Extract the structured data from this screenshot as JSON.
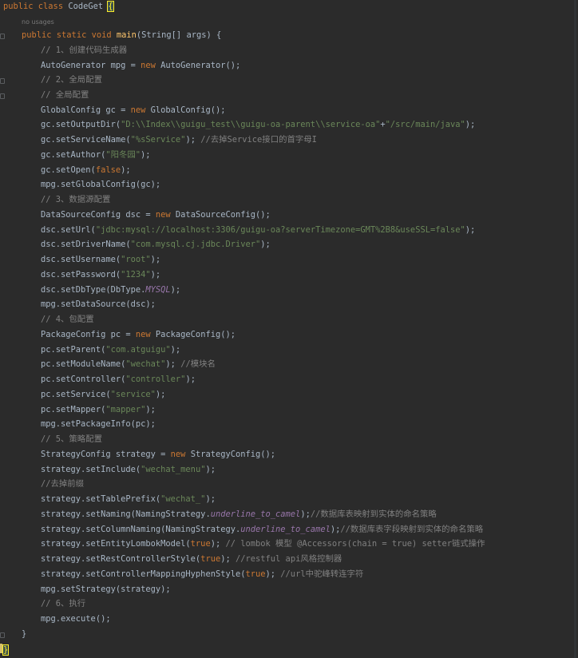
{
  "editor": {
    "usage_hint": "no usages",
    "lines": [
      {
        "indent": 0,
        "tokens": [
          [
            "kw",
            "public class "
          ],
          [
            "plain",
            "CodeGet "
          ],
          [
            "brace",
            "{"
          ]
        ]
      },
      {
        "indent": 0,
        "tokens": []
      },
      {
        "indent": 1,
        "tokens": [
          [
            "kw",
            "public static void "
          ],
          [
            "fn",
            "main"
          ],
          [
            "plain",
            "(String[] args) {"
          ]
        ]
      },
      {
        "indent": 2,
        "tokens": [
          [
            "cmt",
            "// 1、创建代码生成器"
          ]
        ]
      },
      {
        "indent": 2,
        "tokens": [
          [
            "plain",
            "AutoGenerator mpg = "
          ],
          [
            "kw",
            "new "
          ],
          [
            "plain",
            "AutoGenerator();"
          ]
        ]
      },
      {
        "indent": 2,
        "tokens": [
          [
            "cmt",
            "// 2、全局配置"
          ]
        ]
      },
      {
        "indent": 2,
        "tokens": [
          [
            "cmt",
            "// 全局配置"
          ]
        ]
      },
      {
        "indent": 2,
        "tokens": [
          [
            "plain",
            "GlobalConfig gc = "
          ],
          [
            "kw",
            "new "
          ],
          [
            "plain",
            "GlobalConfig();"
          ]
        ]
      },
      {
        "indent": 2,
        "tokens": [
          [
            "plain",
            "gc.setOutputDir("
          ],
          [
            "str",
            "\"D:\\\\Index\\\\guigu_test\\\\guigu-oa-parent\\\\service-oa\""
          ],
          [
            "plain",
            "+"
          ],
          [
            "str",
            "\"/src/main/java\""
          ],
          [
            "plain",
            ");"
          ]
        ]
      },
      {
        "indent": 2,
        "tokens": [
          [
            "plain",
            "gc.setServiceName("
          ],
          [
            "str",
            "\"%sService\""
          ],
          [
            "plain",
            "); "
          ],
          [
            "cmt",
            "//去掉Service接口的首字母I"
          ]
        ]
      },
      {
        "indent": 2,
        "tokens": [
          [
            "plain",
            "gc.setAuthor("
          ],
          [
            "str",
            "\"阳冬园\""
          ],
          [
            "plain",
            ");"
          ]
        ]
      },
      {
        "indent": 2,
        "tokens": [
          [
            "plain",
            "gc.setOpen("
          ],
          [
            "kw",
            "false"
          ],
          [
            "plain",
            ");"
          ]
        ]
      },
      {
        "indent": 2,
        "tokens": [
          [
            "plain",
            "mpg.setGlobalConfig(gc);"
          ]
        ]
      },
      {
        "indent": 2,
        "tokens": [
          [
            "cmt",
            "// 3、数据源配置"
          ]
        ]
      },
      {
        "indent": 2,
        "tokens": [
          [
            "plain",
            "DataSourceConfig dsc = "
          ],
          [
            "kw",
            "new "
          ],
          [
            "plain",
            "DataSourceConfig();"
          ]
        ]
      },
      {
        "indent": 2,
        "tokens": [
          [
            "plain",
            "dsc.setUrl("
          ],
          [
            "str",
            "\"jdbc:mysql://localhost:3306/guigu-oa?serverTimezone=GMT%2B8&useSSL=false\""
          ],
          [
            "plain",
            ");"
          ]
        ]
      },
      {
        "indent": 2,
        "tokens": [
          [
            "plain",
            "dsc.setDriverName("
          ],
          [
            "str",
            "\"com.mysql.cj.jdbc.Driver\""
          ],
          [
            "plain",
            ");"
          ]
        ]
      },
      {
        "indent": 2,
        "tokens": [
          [
            "plain",
            "dsc.setUsername("
          ],
          [
            "str",
            "\"root\""
          ],
          [
            "plain",
            ");"
          ]
        ]
      },
      {
        "indent": 2,
        "tokens": [
          [
            "plain",
            "dsc.setPassword("
          ],
          [
            "str",
            "\"1234\""
          ],
          [
            "plain",
            ");"
          ]
        ]
      },
      {
        "indent": 2,
        "tokens": [
          [
            "plain",
            "dsc.setDbType(DbType."
          ],
          [
            "const",
            "MYSQL"
          ],
          [
            "plain",
            ");"
          ]
        ]
      },
      {
        "indent": 2,
        "tokens": [
          [
            "plain",
            "mpg.setDataSource(dsc);"
          ]
        ]
      },
      {
        "indent": 2,
        "tokens": [
          [
            "cmt",
            "// 4、包配置"
          ]
        ]
      },
      {
        "indent": 2,
        "tokens": [
          [
            "plain",
            "PackageConfig pc = "
          ],
          [
            "kw",
            "new "
          ],
          [
            "plain",
            "PackageConfig();"
          ]
        ]
      },
      {
        "indent": 2,
        "tokens": [
          [
            "plain",
            "pc.setParent("
          ],
          [
            "str",
            "\"com.atguigu\""
          ],
          [
            "plain",
            ");"
          ]
        ]
      },
      {
        "indent": 2,
        "tokens": [
          [
            "plain",
            "pc.setModuleName("
          ],
          [
            "str",
            "\"wechat\""
          ],
          [
            "plain",
            "); "
          ],
          [
            "cmt",
            "//模块名"
          ]
        ]
      },
      {
        "indent": 2,
        "tokens": [
          [
            "plain",
            "pc.setController("
          ],
          [
            "str",
            "\"controller\""
          ],
          [
            "plain",
            ");"
          ]
        ]
      },
      {
        "indent": 2,
        "tokens": [
          [
            "plain",
            "pc.setService("
          ],
          [
            "str",
            "\"service\""
          ],
          [
            "plain",
            ");"
          ]
        ]
      },
      {
        "indent": 2,
        "tokens": [
          [
            "plain",
            "pc.setMapper("
          ],
          [
            "str",
            "\"mapper\""
          ],
          [
            "plain",
            ");"
          ]
        ]
      },
      {
        "indent": 2,
        "tokens": [
          [
            "plain",
            "mpg.setPackageInfo(pc);"
          ]
        ]
      },
      {
        "indent": 2,
        "tokens": [
          [
            "cmt",
            "// 5、策略配置"
          ]
        ]
      },
      {
        "indent": 2,
        "tokens": [
          [
            "plain",
            "StrategyConfig strategy = "
          ],
          [
            "kw",
            "new "
          ],
          [
            "plain",
            "StrategyConfig();"
          ]
        ]
      },
      {
        "indent": 2,
        "tokens": [
          [
            "plain",
            "strategy.setInclude("
          ],
          [
            "str",
            "\"wechat_menu\""
          ],
          [
            "plain",
            ");"
          ]
        ]
      },
      {
        "indent": 2,
        "tokens": [
          [
            "cmt",
            "//去掉前缀"
          ]
        ]
      },
      {
        "indent": 2,
        "tokens": [
          [
            "plain",
            "strategy.setTablePrefix("
          ],
          [
            "str",
            "\"wechat_\""
          ],
          [
            "plain",
            ");"
          ]
        ]
      },
      {
        "indent": 2,
        "tokens": [
          [
            "plain",
            "strategy.setNaming(NamingStrategy."
          ],
          [
            "const",
            "underline_to_camel"
          ],
          [
            "plain",
            ");"
          ],
          [
            "cmt",
            "//数据库表映射到实体的命名策略"
          ]
        ]
      },
      {
        "indent": 2,
        "tokens": [
          [
            "plain",
            "strategy.setColumnNaming(NamingStrategy."
          ],
          [
            "const",
            "underline_to_camel"
          ],
          [
            "plain",
            ");"
          ],
          [
            "cmt",
            "//数据库表字段映射到实体的命名策略"
          ]
        ]
      },
      {
        "indent": 2,
        "tokens": [
          [
            "plain",
            "strategy.setEntityLombokModel("
          ],
          [
            "kw",
            "true"
          ],
          [
            "plain",
            "); "
          ],
          [
            "cmt",
            "// lombok 模型 @Accessors(chain = true) setter链式操作"
          ]
        ]
      },
      {
        "indent": 2,
        "tokens": [
          [
            "plain",
            "strategy.setRestControllerStyle("
          ],
          [
            "kw",
            "true"
          ],
          [
            "plain",
            "); "
          ],
          [
            "cmt",
            "//restful api风格控制器"
          ]
        ]
      },
      {
        "indent": 2,
        "tokens": [
          [
            "plain",
            "strategy.setControllerMappingHyphenStyle("
          ],
          [
            "kw",
            "true"
          ],
          [
            "plain",
            "); "
          ],
          [
            "cmt",
            "//url中驼峰转连字符"
          ]
        ]
      },
      {
        "indent": 2,
        "tokens": [
          [
            "plain",
            "mpg.setStrategy(strategy);"
          ]
        ]
      },
      {
        "indent": 2,
        "tokens": [
          [
            "cmt",
            "// 6、执行"
          ]
        ]
      },
      {
        "indent": 2,
        "tokens": [
          [
            "plain",
            "mpg.execute();"
          ]
        ]
      },
      {
        "indent": 1,
        "tokens": [
          [
            "plain",
            "}"
          ]
        ]
      },
      {
        "indent": 0,
        "tokens": [
          [
            "brace",
            "}"
          ]
        ]
      }
    ]
  },
  "colors": {
    "background": "#2b2b2b",
    "keyword": "#cc7832",
    "string": "#6a8759",
    "comment": "#808080",
    "method": "#ffc66d",
    "constant": "#9876aa",
    "text": "#a9b7c6"
  }
}
